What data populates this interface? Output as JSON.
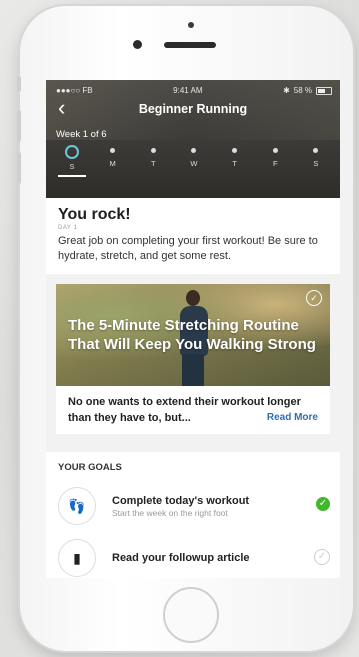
{
  "status_bar": {
    "carrier": "●●●○○ FB",
    "time": "9:41 AM",
    "battery": "58 %"
  },
  "header": {
    "title": "Beginner Running",
    "week_label": "Week 1 of 6"
  },
  "days": [
    "S",
    "M",
    "T",
    "W",
    "T",
    "F",
    "S"
  ],
  "celebration": {
    "title": "You rock!",
    "day_label": "DAY 1",
    "message": "Great job on completing your first workout! Be sure to hydrate, stretch, and get some rest."
  },
  "article": {
    "headline": "The 5-Minute Stretching Routine That Will Keep You Walking Strong",
    "excerpt": "No one wants to extend their workout longer than they have to, but...",
    "read_more": "Read More"
  },
  "goals": {
    "header": "YOUR GOALS",
    "items": [
      {
        "title": "Complete today's workout",
        "subtitle": "Start the week on the right foot",
        "done": true
      },
      {
        "title": "Read your followup article",
        "subtitle": "",
        "done": false
      }
    ]
  },
  "colors": {
    "accent": "#2f6fb0",
    "done": "#3fb82a",
    "active_ring": "#6ec7dd"
  },
  "icons": {
    "back": "chevron-left-icon",
    "workout": "footsteps-icon",
    "article": "book-icon",
    "check": "check-icon"
  }
}
